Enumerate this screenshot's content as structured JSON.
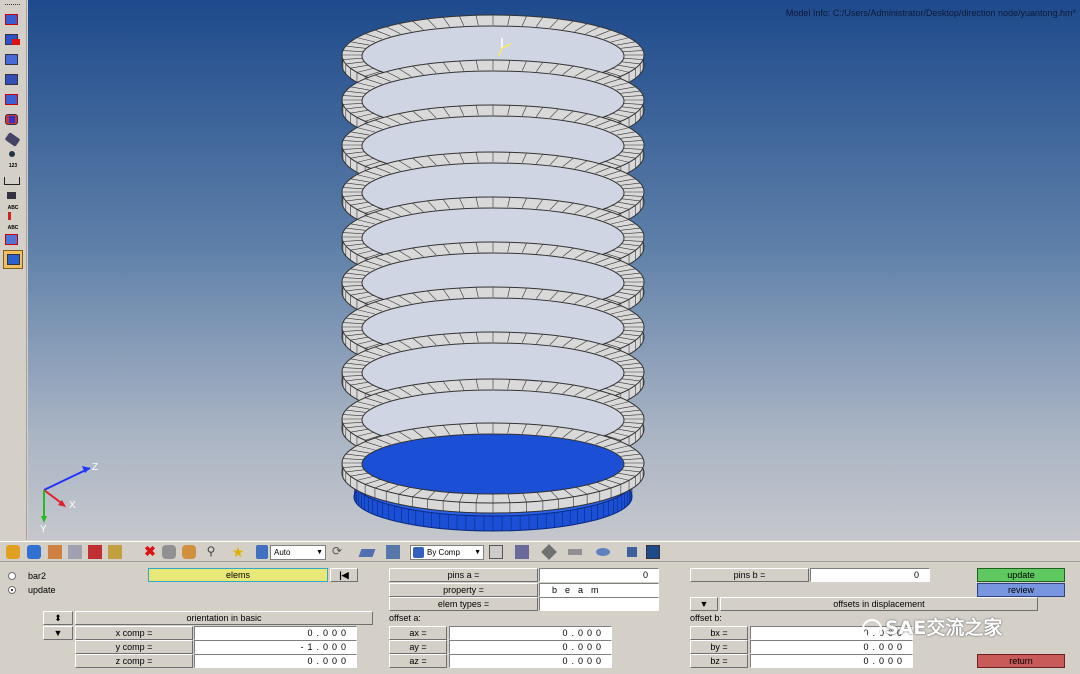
{
  "viewport": {
    "model_info": "Model Info: C:/Users/Administrator/Desktop/direction node/yuantong.hm*",
    "axis_labels": {
      "z": "Z",
      "x": "X",
      "y": "Y"
    },
    "left_toolbar_labels": {
      "numbering": "123",
      "abc_1": "ABC",
      "abc_2": "ABC"
    },
    "colors": {
      "mesh": "#d9d9d9",
      "mesh_edge": "#333333",
      "selected": "#1a4fd6",
      "outline": "#3a5ee8"
    }
  },
  "toolbar": {
    "auto_label": "Auto",
    "by_comp_label": "By Comp"
  },
  "panel": {
    "radio_bar2": "bar2",
    "radio_update": "update",
    "elems_button": "elems",
    "orientation_basic": "orientation in basic",
    "x_comp_label": "x comp =",
    "x_comp_value": "0.000",
    "y_comp_label": "y comp =",
    "y_comp_value": "-1.000",
    "z_comp_label": "z comp =",
    "z_comp_value": "0.000",
    "pins_a_label": "pins  a =",
    "pins_a_value": "0",
    "property_label": "property =",
    "property_value": "beam",
    "elem_types_label": "elem types =",
    "elem_types_value": "",
    "offset_a_label": "offset a:",
    "ax_label": "ax =",
    "ax_value": "0.000",
    "ay_label": "ay =",
    "ay_value": "0.000",
    "az_label": "az =",
    "az_value": "0.000",
    "pins_b_label": "pins b =",
    "pins_b_value": "0",
    "offsets_in_displacement": "offsets in displacement",
    "offset_b_label": "offset b:",
    "bx_label": "bx =",
    "bx_value": "0.000",
    "by_label": "by =",
    "by_value": "0.000",
    "bz_label": "bz =",
    "bz_value": "0.000",
    "update_button": "update",
    "review_button": "review",
    "return_button": "return"
  },
  "watermark": "SAE交流之家"
}
